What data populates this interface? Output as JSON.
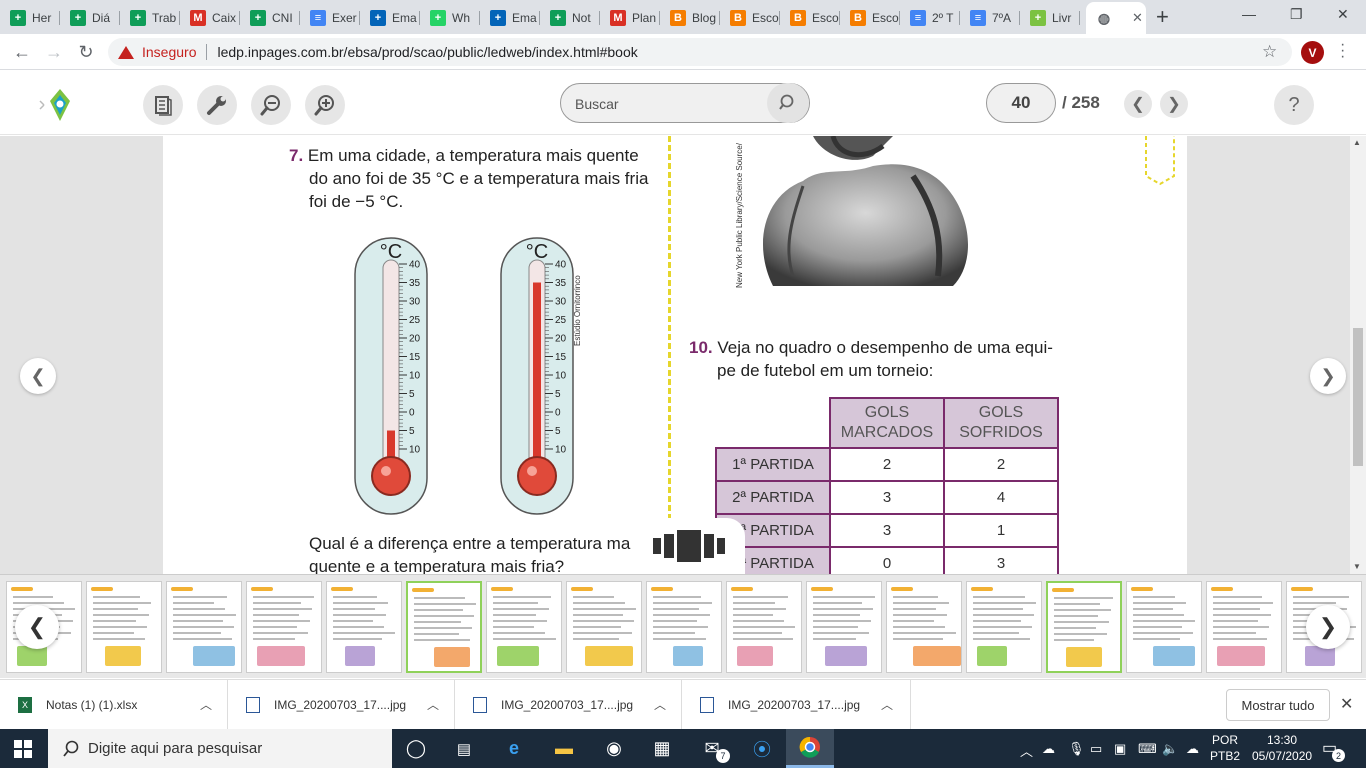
{
  "browser": {
    "tabs": [
      {
        "label": "Her",
        "favicon": "sheets-icon",
        "color": "#0f9d58"
      },
      {
        "label": "Diá",
        "favicon": "sheets-icon",
        "color": "#0f9d58"
      },
      {
        "label": "Trab",
        "favicon": "sheets-icon",
        "color": "#0f9d58"
      },
      {
        "label": "Caix",
        "favicon": "gmail-icon",
        "color": "#d93025"
      },
      {
        "label": "CNI",
        "favicon": "sheets-icon",
        "color": "#0f9d58"
      },
      {
        "label": "Exer",
        "favicon": "docs-icon",
        "color": "#4285f4"
      },
      {
        "label": "Ema",
        "favicon": "outlook-icon",
        "color": "#0364b8"
      },
      {
        "label": "Wh",
        "favicon": "whatsapp-icon",
        "color": "#25d366"
      },
      {
        "label": "Ema",
        "favicon": "outlook-icon",
        "color": "#0364b8"
      },
      {
        "label": "Not",
        "favicon": "sheets-icon",
        "color": "#0f9d58"
      },
      {
        "label": "Plan",
        "favicon": "gmail-icon",
        "color": "#d93025"
      },
      {
        "label": "Blog",
        "favicon": "blogger-icon",
        "color": "#f57d00"
      },
      {
        "label": "Esco",
        "favicon": "blogger-icon",
        "color": "#f57d00"
      },
      {
        "label": "Esco",
        "favicon": "blogger-icon",
        "color": "#f57d00"
      },
      {
        "label": "Esco",
        "favicon": "blogger-icon",
        "color": "#f57d00"
      },
      {
        "label": "2º T",
        "favicon": "docs-icon",
        "color": "#4285f4"
      },
      {
        "label": "7ºA",
        "favicon": "docs-icon",
        "color": "#4285f4"
      },
      {
        "label": "Livr",
        "favicon": "ledweb-icon",
        "color": "#7cc242"
      }
    ],
    "active_tab_favicon": "globe-icon",
    "address": {
      "security_label": "Inseguro",
      "url": "ledp.inpages.com.br/ebsa/prod/scao/public/ledweb/index.html#book"
    },
    "profile_initial": "V"
  },
  "reader": {
    "search_placeholder": "Buscar",
    "current_page": "40",
    "total_pages": "/ 258",
    "help_label": "?"
  },
  "book_page": {
    "q7": {
      "number": "7.",
      "line1": "Em uma cidade, a temperatura mais quente",
      "line2": "do ano foi de 35 °C e a temperatura mais fria",
      "line3": "foi de −5 °C.",
      "question_line1": "Qual é a diferença entre a temperatura ma",
      "question_line2": "quente e a temperatura mais fria?"
    },
    "thermometer_unit": "°C",
    "thermometer_ticks": [
      "40",
      "35",
      "30",
      "25",
      "20",
      "15",
      "10",
      "5",
      "0",
      "5",
      "10"
    ],
    "thermometers": [
      {
        "reading": -5
      },
      {
        "reading": 35
      }
    ],
    "credit_thermo": "Estúdio Ornitorrinco",
    "credit_photo": "New York Public Library/Science Source/",
    "q10": {
      "number": "10.",
      "line1": "Veja no quadro o desempenho de uma equi-",
      "line2": "pe de futebol em um torneio:"
    },
    "table": {
      "headers": [
        "GOLS MARCADOS",
        "GOLS SOFRIDOS"
      ],
      "rows": [
        {
          "label": "1ª PARTIDA",
          "scored": "2",
          "conceded": "2"
        },
        {
          "label": "2ª PARTIDA",
          "scored": "3",
          "conceded": "4"
        },
        {
          "label": "3ª PARTIDA",
          "scored": "3",
          "conceded": "1"
        },
        {
          "label": "4ª PARTIDA",
          "scored": "0",
          "conceded": "3"
        }
      ]
    }
  },
  "thumbnails": {
    "selected_indices": [
      5,
      13
    ],
    "count": 17
  },
  "downloads": {
    "items": [
      {
        "name": "Notas (1) (1).xlsx",
        "icon": "excel-icon"
      },
      {
        "name": "IMG_20200703_17....jpg",
        "icon": "image-file-icon"
      },
      {
        "name": "IMG_20200703_17....jpg",
        "icon": "image-file-icon"
      },
      {
        "name": "IMG_20200703_17....jpg",
        "icon": "image-file-icon"
      }
    ],
    "show_all_label": "Mostrar tudo"
  },
  "taskbar": {
    "search_placeholder": "Digite aqui para pesquisar",
    "lang_line1": "POR",
    "lang_line2": "PTB2",
    "time": "13:30",
    "date": "05/07/2020",
    "mail_badge": "7",
    "notification_count": "2"
  }
}
